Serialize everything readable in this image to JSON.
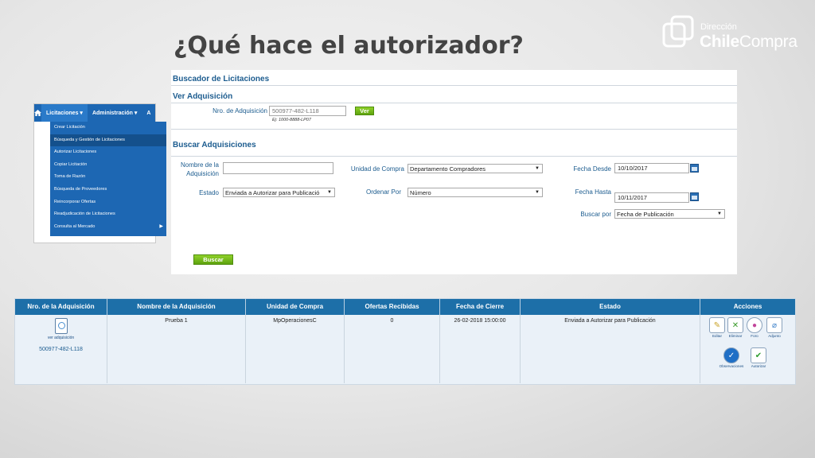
{
  "slide": {
    "title": "¿Qué hace el autorizador?"
  },
  "logo": {
    "small": "Dirección",
    "brand_bold": "Chile",
    "brand_regular": "Compra"
  },
  "menu": {
    "top": [
      "Licitaciones",
      "Administración",
      "A"
    ],
    "items": [
      "Crear Licitación",
      "Búsqueda y Gestión de Licitaciones",
      "Autorizar Licitaciones",
      "Copiar Licitación",
      "Toma de Razón",
      "Búsqueda de Proveedores",
      "Reincorporar Ofertas",
      "Readjudicación de Licitaciones",
      "Consulta al Mercado"
    ]
  },
  "search": {
    "title": "Buscador de Licitaciones",
    "ver": {
      "title": "Ver Adquisición",
      "nro_label": "Nro. de Adquisición",
      "nro_placeholder": "500977-482-L118",
      "example": "Ej: 1000-8888-LP07",
      "button": "Ver"
    },
    "buscar": {
      "title": "Buscar Adquisiciones",
      "nombre_label_1": "Nombre de la",
      "nombre_label_2": "Adquisición",
      "nombre_value": "",
      "unidad_label": "Unidad de Compra",
      "unidad_value": "Departamento Compradores",
      "fecha_desde_label": "Fecha Desde",
      "fecha_desde_value": "10/10/2017",
      "estado_label": "Estado",
      "estado_value": "Enviada a Autorizar para Publicació",
      "ordenar_label": "Ordenar Por",
      "ordenar_value": "Número",
      "fecha_hasta_label": "Fecha Hasta",
      "fecha_hasta_value": "10/11/2017",
      "buscar_por_label": "Buscar por",
      "buscar_por_value": "Fecha de Publicación",
      "button": "Buscar"
    }
  },
  "results": {
    "headers": [
      "Nro. de la Adquisición",
      "Nombre de la Adquisición",
      "Unidad de Compra",
      "Ofertas Recibidas",
      "Fecha de Cierre",
      "Estado",
      "Acciones"
    ],
    "row": {
      "icon_label": "ver adquisición",
      "nro": "500977-482-L118",
      "nombre": "Prueba 1",
      "unidad": "MpOperacionesC",
      "ofertas": "0",
      "cierre": "26-02-2018 15:00:00",
      "estado": "Enviada a Autorizar para Publicación"
    },
    "actions": [
      "Editar",
      "Eliminar",
      "Foro",
      "Adjunto",
      "Observaciones",
      "Autorizar"
    ]
  }
}
